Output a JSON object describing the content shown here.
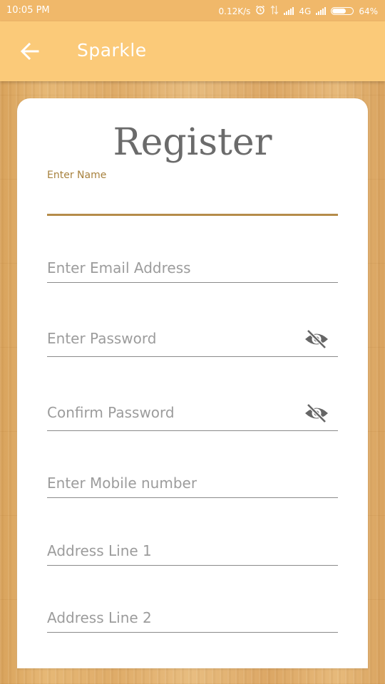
{
  "status_bar": {
    "time": "10:05 PM",
    "net_speed": "0.12K/s",
    "network_type": "4G",
    "battery": "64%",
    "icons": [
      "alarm-icon",
      "data-arrows-icon",
      "signal-icon",
      "signal-icon",
      "battery-icon"
    ]
  },
  "app_bar": {
    "back_icon": "arrow-left-icon",
    "title": "Sparkle",
    "background": "#fbca79"
  },
  "form": {
    "title": "Register",
    "fields": [
      {
        "label": "Enter Name",
        "value": "",
        "focused": true
      },
      {
        "label": "Enter Email Address",
        "value": ""
      },
      {
        "label": "Enter Password",
        "value": "",
        "trailing_icon": "eye-off-icon"
      },
      {
        "label": "Confirm Password",
        "value": "",
        "trailing_icon": "eye-off-icon"
      },
      {
        "label": "Enter Mobile number",
        "value": ""
      },
      {
        "label": "Address Line 1",
        "value": ""
      },
      {
        "label": "Address Line 2",
        "value": ""
      }
    ]
  },
  "colors": {
    "accent": "#a7813d",
    "status_bar": "#f0b86a",
    "title_text": "#6b6b6b"
  }
}
